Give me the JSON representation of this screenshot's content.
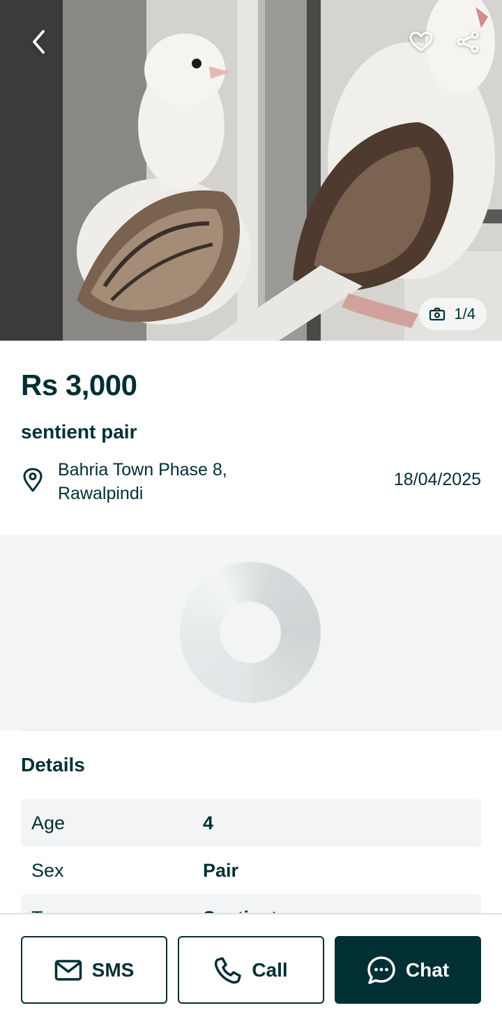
{
  "gallery": {
    "counter": "1/4",
    "back_icon": "chevron-left-icon",
    "favorite_icon": "heart-icon",
    "share_icon": "share-icon",
    "camera_icon": "camera-icon"
  },
  "listing": {
    "price": "Rs 3,000",
    "title": "sentient pair",
    "location": "Bahria Town Phase 8, Rawalpindi",
    "date": "18/04/2025"
  },
  "details": {
    "heading": "Details",
    "rows": [
      {
        "key": "Age",
        "value": "4"
      },
      {
        "key": "Sex",
        "value": "Pair"
      },
      {
        "key": "T",
        "value": "Sentient"
      }
    ]
  },
  "actions": {
    "sms": "SMS",
    "call": "Call",
    "chat": "Chat"
  },
  "colors": {
    "primary": "#002f34",
    "panel": "#f2f4f5"
  }
}
